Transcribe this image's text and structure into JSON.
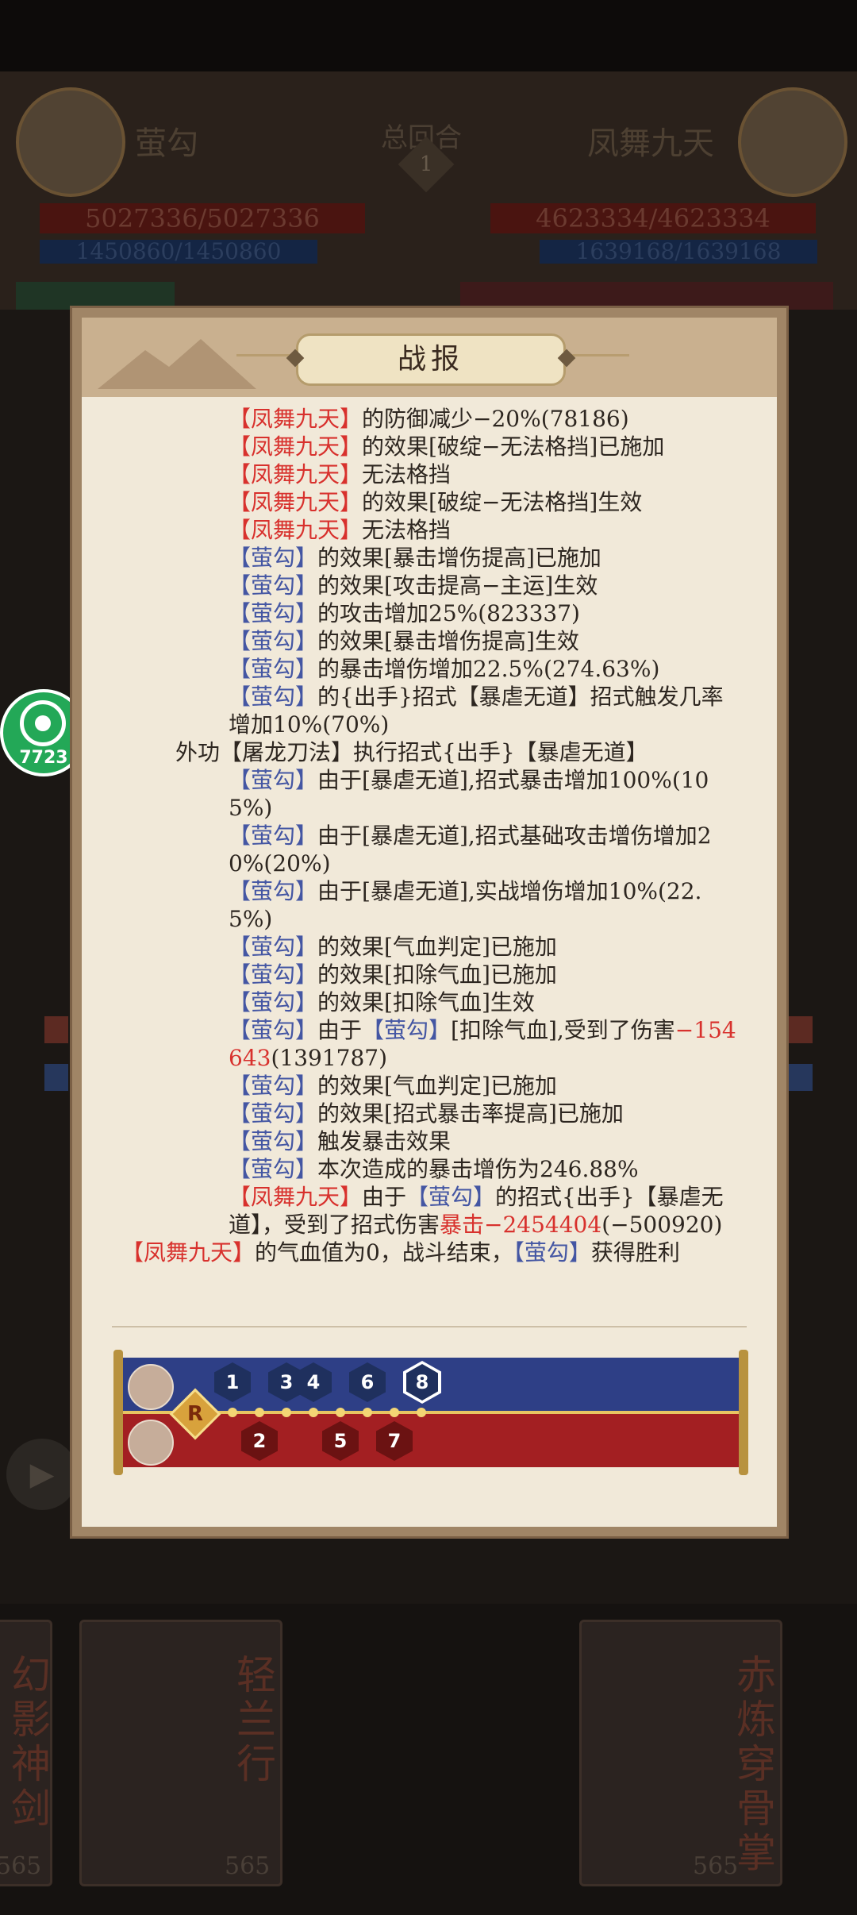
{
  "background": {
    "left_player": "萤勾",
    "right_player": "凤舞九天",
    "round_label": "总回合",
    "round_number": "1",
    "left_hp": "5027336/5027336",
    "left_mp": "1450860/1450860",
    "right_hp": "4623334/4623334",
    "right_mp": "1639168/1639168",
    "cards": [
      {
        "title": "幻影神剑",
        "cost": "565"
      },
      {
        "title": "轻兰行",
        "cost": "565"
      },
      {
        "title": "赤炼穿骨掌",
        "cost": "565"
      }
    ]
  },
  "overlay_widget": {
    "label": "7723"
  },
  "dialog": {
    "title": "战报",
    "log": [
      {
        "indent": "ind",
        "parts": [
          {
            "t": "【凤舞九天】",
            "c": "red"
          },
          {
            "t": "的防御减少−20%(78186)"
          }
        ]
      },
      {
        "indent": "ind",
        "parts": [
          {
            "t": "【凤舞九天】",
            "c": "red"
          },
          {
            "t": "的效果[破绽−无法格挡]已施加"
          }
        ]
      },
      {
        "indent": "ind",
        "parts": [
          {
            "t": "【凤舞九天】",
            "c": "red"
          },
          {
            "t": "无法格挡"
          }
        ]
      },
      {
        "indent": "ind",
        "parts": [
          {
            "t": "【凤舞九天】",
            "c": "red"
          },
          {
            "t": "的效果[破绽−无法格挡]生效"
          }
        ]
      },
      {
        "indent": "ind",
        "parts": [
          {
            "t": "【凤舞九天】",
            "c": "red"
          },
          {
            "t": "无法格挡"
          }
        ]
      },
      {
        "indent": "ind",
        "parts": [
          {
            "t": "【萤勾】",
            "c": "blue"
          },
          {
            "t": "的效果[暴击增伤提高]已施加"
          }
        ]
      },
      {
        "indent": "ind",
        "parts": [
          {
            "t": "【萤勾】",
            "c": "blue"
          },
          {
            "t": "的效果[攻击提高−主运]生效"
          }
        ]
      },
      {
        "indent": "ind",
        "parts": [
          {
            "t": "【萤勾】",
            "c": "blue"
          },
          {
            "t": "的攻击增加25%(823337)"
          }
        ]
      },
      {
        "indent": "ind",
        "parts": [
          {
            "t": "【萤勾】",
            "c": "blue"
          },
          {
            "t": "的效果[暴击增伤提高]生效"
          }
        ]
      },
      {
        "indent": "ind",
        "parts": [
          {
            "t": "【萤勾】",
            "c": "blue"
          },
          {
            "t": "的暴击增伤增加22.5%(274.63%)"
          }
        ]
      },
      {
        "indent": "ind",
        "parts": [
          {
            "t": "【萤勾】",
            "c": "blue"
          },
          {
            "t": "的{出手}招式【暴虐无道】招式触发几率增加10%(70%)"
          }
        ]
      },
      {
        "indent": "ind2",
        "parts": [
          {
            "t": "外功【屠龙刀法】执行招式{出手}【暴虐无道】"
          }
        ]
      },
      {
        "indent": "ind",
        "parts": [
          {
            "t": "【萤勾】",
            "c": "blue"
          },
          {
            "t": "由于[暴虐无道],招式暴击增加100%(105%)"
          }
        ]
      },
      {
        "indent": "ind",
        "parts": [
          {
            "t": "【萤勾】",
            "c": "blue"
          },
          {
            "t": "由于[暴虐无道],招式基础攻击增伤增加20%(20%)"
          }
        ]
      },
      {
        "indent": "ind",
        "parts": [
          {
            "t": "【萤勾】",
            "c": "blue"
          },
          {
            "t": "由于[暴虐无道],实战增伤增加10%(22.5%)"
          }
        ]
      },
      {
        "indent": "ind",
        "parts": [
          {
            "t": "【萤勾】",
            "c": "blue"
          },
          {
            "t": "的效果[气血判定]已施加"
          }
        ]
      },
      {
        "indent": "ind",
        "parts": [
          {
            "t": "【萤勾】",
            "c": "blue"
          },
          {
            "t": "的效果[扣除气血]已施加"
          }
        ]
      },
      {
        "indent": "ind",
        "parts": [
          {
            "t": "【萤勾】",
            "c": "blue"
          },
          {
            "t": "的效果[扣除气血]生效"
          }
        ]
      },
      {
        "indent": "ind",
        "parts": [
          {
            "t": "【萤勾】",
            "c": "blue"
          },
          {
            "t": "由于"
          },
          {
            "t": "【萤勾】",
            "c": "blue"
          },
          {
            "t": "[扣除气血],受到了伤害"
          },
          {
            "t": "−154643",
            "c": "red"
          },
          {
            "t": "(1391787)"
          }
        ]
      },
      {
        "indent": "ind",
        "parts": [
          {
            "t": "【萤勾】",
            "c": "blue"
          },
          {
            "t": "的效果[气血判定]已施加"
          }
        ]
      },
      {
        "indent": "ind",
        "parts": [
          {
            "t": "【萤勾】",
            "c": "blue"
          },
          {
            "t": "的效果[招式暴击率提高]已施加"
          }
        ]
      },
      {
        "indent": "ind",
        "parts": [
          {
            "t": "【萤勾】",
            "c": "blue"
          },
          {
            "t": "触发暴击效果"
          }
        ]
      },
      {
        "indent": "ind",
        "parts": [
          {
            "t": "【萤勾】",
            "c": "blue"
          },
          {
            "t": "本次造成的暴击增伤为246.88%"
          }
        ]
      },
      {
        "indent": "ind",
        "parts": [
          {
            "t": "【凤舞九天】",
            "c": "red"
          },
          {
            "t": "由于"
          },
          {
            "t": "【萤勾】",
            "c": "blue"
          },
          {
            "t": "的招式{出手}【暴虐无道】，受到了招式伤害"
          },
          {
            "t": "暴击−2454404",
            "c": "red"
          },
          {
            "t": "(−500920)"
          }
        ]
      },
      {
        "indent": "",
        "parts": [
          {
            "t": "【凤舞九天】",
            "c": "red"
          },
          {
            "t": "的气血值为0，战斗结束，"
          },
          {
            "t": "【萤勾】",
            "c": "blue"
          },
          {
            "t": "获得胜利"
          }
        ]
      }
    ],
    "timeline": {
      "blue_turns": [
        "1",
        "3",
        "4",
        "6",
        "8"
      ],
      "red_turns": [
        "2",
        "5",
        "7"
      ],
      "current_turn": "8",
      "start_marker": "R"
    }
  }
}
